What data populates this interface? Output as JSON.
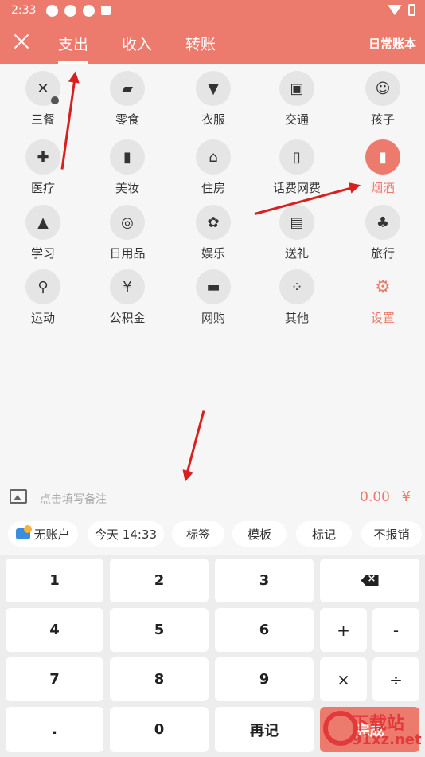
{
  "status_bar": {
    "time": "2:33"
  },
  "header": {
    "tabs": [
      {
        "label": "支出",
        "active": true
      },
      {
        "label": "收入",
        "active": false
      },
      {
        "label": "转账",
        "active": false
      }
    ],
    "ledger": "日常账本"
  },
  "categories": [
    {
      "label": "三餐",
      "icon": "fork-knife-icon",
      "glyph": "✕"
    },
    {
      "label": "零食",
      "icon": "cupcake-icon",
      "glyph": "▰"
    },
    {
      "label": "衣服",
      "icon": "shirt-icon",
      "glyph": "▼"
    },
    {
      "label": "交通",
      "icon": "bus-icon",
      "glyph": "▣"
    },
    {
      "label": "孩子",
      "icon": "baby-face-icon",
      "glyph": "☺"
    },
    {
      "label": "医疗",
      "icon": "medicine-bottle-icon",
      "glyph": "✚"
    },
    {
      "label": "美妆",
      "icon": "lipstick-icon",
      "glyph": "▮"
    },
    {
      "label": "住房",
      "icon": "house-icon",
      "glyph": "⌂"
    },
    {
      "label": "话费网费",
      "icon": "phone-bill-icon",
      "glyph": "▯"
    },
    {
      "label": "烟酒",
      "icon": "tobacco-wine-icon",
      "glyph": "▮"
    },
    {
      "label": "学习",
      "icon": "student-icon",
      "glyph": "▲"
    },
    {
      "label": "日用品",
      "icon": "tissue-roll-icon",
      "glyph": "◎"
    },
    {
      "label": "娱乐",
      "icon": "film-reel-icon",
      "glyph": "✿"
    },
    {
      "label": "送礼",
      "icon": "gift-icon",
      "glyph": "▤"
    },
    {
      "label": "旅行",
      "icon": "palm-tree-icon",
      "glyph": "♣"
    },
    {
      "label": "运动",
      "icon": "cycling-icon",
      "glyph": "⚲"
    },
    {
      "label": "公积金",
      "icon": "house-fund-icon",
      "glyph": "¥"
    },
    {
      "label": "网购",
      "icon": "shopping-cart-icon",
      "glyph": "▬"
    },
    {
      "label": "其他",
      "icon": "four-dots-icon",
      "glyph": "⁘"
    },
    {
      "label": "设置",
      "icon": "gear-icon",
      "glyph": "⚙"
    }
  ],
  "note": {
    "placeholder": "点击填写备注",
    "amount": "0.00",
    "currency": "¥"
  },
  "chips": [
    "无账户",
    "今天 14:33",
    "标签",
    "模板",
    "标记",
    "不报销"
  ],
  "keypad": {
    "keys": [
      "1",
      "2",
      "3",
      "4",
      "5",
      "6",
      "+",
      "-",
      "7",
      "8",
      "9",
      "×",
      "÷",
      ".",
      "0",
      "再记",
      "完成"
    ]
  },
  "watermark": {
    "line1": "下载站",
    "line2": "91xz.net"
  },
  "colors": {
    "accent": "#ec7b6d",
    "arrow": "#d82020"
  }
}
